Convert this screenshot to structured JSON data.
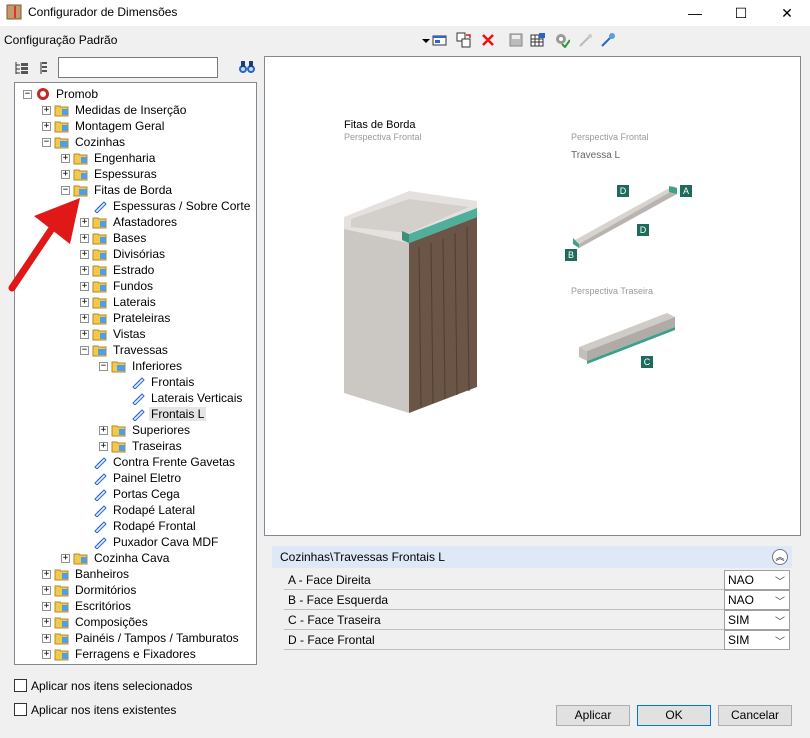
{
  "window": {
    "title": "Configurador de Dimensões",
    "minimize": "—",
    "maximize": "☐",
    "close": "✕"
  },
  "toolbar": {
    "config_label": "Configuração Padrão",
    "icons": [
      "dropdown-arrow-icon",
      "window-icon",
      "copy-icon",
      "delete-icon",
      "save-icon",
      "grid-icon",
      "settings-check-icon",
      "wand-icon",
      "brush-icon"
    ]
  },
  "search": {
    "value": "",
    "placeholder": ""
  },
  "tree": [
    {
      "label": "Promob",
      "level": 0,
      "exp": "−",
      "kind": "root"
    },
    {
      "label": "Medidas de Inserção",
      "level": 1,
      "exp": "+",
      "kind": "folder"
    },
    {
      "label": "Montagem Geral",
      "level": 1,
      "exp": "+",
      "kind": "folder"
    },
    {
      "label": "Cozinhas",
      "level": 1,
      "exp": "−",
      "kind": "folder-open"
    },
    {
      "label": "Engenharia",
      "level": 2,
      "exp": "+",
      "kind": "folder"
    },
    {
      "label": "Espessuras",
      "level": 2,
      "exp": "+",
      "kind": "folder"
    },
    {
      "label": "Fitas de Borda",
      "level": 2,
      "exp": "−",
      "kind": "folder-open"
    },
    {
      "label": "Espessuras / Sobre Corte",
      "level": 3,
      "exp": "",
      "kind": "item"
    },
    {
      "label": "Afastadores",
      "level": 3,
      "exp": "+",
      "kind": "folder"
    },
    {
      "label": "Bases",
      "level": 3,
      "exp": "+",
      "kind": "folder"
    },
    {
      "label": "Divisórias",
      "level": 3,
      "exp": "+",
      "kind": "folder"
    },
    {
      "label": "Estrado",
      "level": 3,
      "exp": "+",
      "kind": "folder"
    },
    {
      "label": "Fundos",
      "level": 3,
      "exp": "+",
      "kind": "folder"
    },
    {
      "label": "Laterais",
      "level": 3,
      "exp": "+",
      "kind": "folder"
    },
    {
      "label": "Prateleiras",
      "level": 3,
      "exp": "+",
      "kind": "folder"
    },
    {
      "label": "Vistas",
      "level": 3,
      "exp": "+",
      "kind": "folder"
    },
    {
      "label": "Travessas",
      "level": 3,
      "exp": "−",
      "kind": "folder-open"
    },
    {
      "label": "Inferiores",
      "level": 4,
      "exp": "−",
      "kind": "folder-open"
    },
    {
      "label": "Frontais",
      "level": 5,
      "exp": "",
      "kind": "item"
    },
    {
      "label": "Laterais Verticais",
      "level": 5,
      "exp": "",
      "kind": "item"
    },
    {
      "label": "Frontais L",
      "level": 5,
      "exp": "",
      "kind": "item",
      "selected": true
    },
    {
      "label": "Superiores",
      "level": 4,
      "exp": "+",
      "kind": "folder"
    },
    {
      "label": "Traseiras",
      "level": 4,
      "exp": "+",
      "kind": "folder"
    },
    {
      "label": "Contra Frente Gavetas",
      "level": 3,
      "exp": "",
      "kind": "item"
    },
    {
      "label": "Painel Eletro",
      "level": 3,
      "exp": "",
      "kind": "item"
    },
    {
      "label": "Portas Cega",
      "level": 3,
      "exp": "",
      "kind": "item"
    },
    {
      "label": "Rodapé Lateral",
      "level": 3,
      "exp": "",
      "kind": "item"
    },
    {
      "label": "Rodapé Frontal",
      "level": 3,
      "exp": "",
      "kind": "item"
    },
    {
      "label": "Puxador Cava MDF",
      "level": 3,
      "exp": "",
      "kind": "item"
    },
    {
      "label": "Cozinha Cava",
      "level": 2,
      "exp": "+",
      "kind": "folder"
    },
    {
      "label": "Banheiros",
      "level": 1,
      "exp": "+",
      "kind": "folder"
    },
    {
      "label": "Dormitórios",
      "level": 1,
      "exp": "+",
      "kind": "folder"
    },
    {
      "label": "Escritórios",
      "level": 1,
      "exp": "+",
      "kind": "folder"
    },
    {
      "label": "Composições",
      "level": 1,
      "exp": "+",
      "kind": "folder"
    },
    {
      "label": "Painéis / Tampos / Tamburatos",
      "level": 1,
      "exp": "+",
      "kind": "folder"
    },
    {
      "label": "Ferragens e Fixadores",
      "level": 1,
      "exp": "+",
      "kind": "folder"
    }
  ],
  "preview": {
    "title": "Fitas de Borda",
    "subtitle": "Perspectiva Frontal",
    "front_caption": "Perspectiva Frontal",
    "front_sub": "Travessa L",
    "back_caption": "Perspectiva Traseira",
    "labels": {
      "a": "A",
      "b": "B",
      "c": "C",
      "d1": "D",
      "d2": "D"
    },
    "accent": "#1e6b5c"
  },
  "properties": {
    "header": "Cozinhas\\Travessas Frontais L",
    "rows": [
      {
        "name": "A - Face Direita",
        "value": "NAO"
      },
      {
        "name": "B - Face Esquerda",
        "value": "NAO"
      },
      {
        "name": "C - Face Traseira",
        "value": "SIM"
      },
      {
        "name": "D - Face Frontal",
        "value": "SIM"
      }
    ]
  },
  "options": {
    "selected_items": "Aplicar nos itens selecionados",
    "existing_items": "Aplicar nos itens existentes"
  },
  "buttons": {
    "apply": "Aplicar",
    "ok": "OK",
    "cancel": "Cancelar"
  }
}
